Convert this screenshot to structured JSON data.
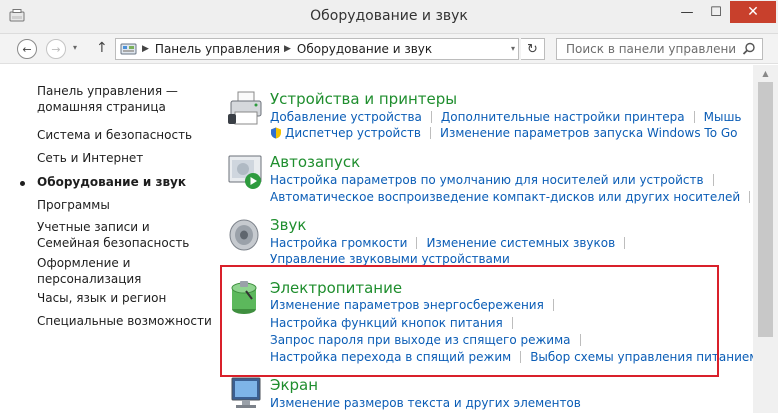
{
  "window": {
    "title": "Оборудование и звук",
    "controls": {
      "minimize": "—",
      "maximize": "☐",
      "close": "✕"
    }
  },
  "nav": {
    "back_glyph": "←",
    "forward_glyph": "→",
    "history_glyph": "▾",
    "up_glyph": "↑",
    "refresh_glyph": "↻",
    "breadcrumbs": [
      "Панель управления",
      "Оборудование и звук"
    ],
    "search_placeholder": "Поиск в панели управления"
  },
  "sidebar": {
    "items": [
      {
        "label": "Панель управления — домашняя страница"
      },
      {
        "label": "Система и безопасность"
      },
      {
        "label": "Сеть и Интернет"
      },
      {
        "label": "Оборудование и звук",
        "current": true
      },
      {
        "label": "Программы"
      },
      {
        "label": "Учетные записи и Семейная безопасность"
      },
      {
        "label": "Оформление и персонализация"
      },
      {
        "label": "Часы, язык и регион"
      },
      {
        "label": "Специальные возможности"
      }
    ]
  },
  "categories": [
    {
      "title": "Устройства и принтеры",
      "icon": "printer-icon",
      "rows": [
        [
          "Добавление устройства",
          "Дополнительные настройки принтера",
          "Мышь"
        ],
        [
          "Диспетчер устройств",
          "Изменение параметров запуска Windows To Go"
        ]
      ]
    },
    {
      "title": "Автозапуск",
      "icon": "autoplay-icon",
      "rows": [
        [
          "Настройка параметров по умолчанию для носителей или устройств"
        ],
        [
          "Автоматическое воспроизведение компакт-дисков или других носителей"
        ]
      ]
    },
    {
      "title": "Звук",
      "icon": "speaker-icon",
      "rows": [
        [
          "Настройка громкости",
          "Изменение системных звуков"
        ],
        [
          "Управление звуковыми устройствами"
        ]
      ]
    },
    {
      "title": "Электропитание",
      "icon": "battery-icon",
      "rows": [
        [
          "Изменение параметров энергосбережения"
        ],
        [
          "Настройка функций кнопок питания"
        ],
        [
          "Запрос пароля при выходе из спящего режима"
        ],
        [
          "Настройка перехода в спящий режим",
          "Выбор схемы управления питанием"
        ]
      ]
    },
    {
      "title": "Экран",
      "icon": "monitor-icon",
      "rows": [
        [
          "Изменение размеров текста и других элементов"
        ]
      ]
    }
  ],
  "colors": {
    "link": "#0b5db6",
    "category_title": "#1f8e2e",
    "highlight_border": "#d9202a",
    "close_button": "#c8402c"
  }
}
